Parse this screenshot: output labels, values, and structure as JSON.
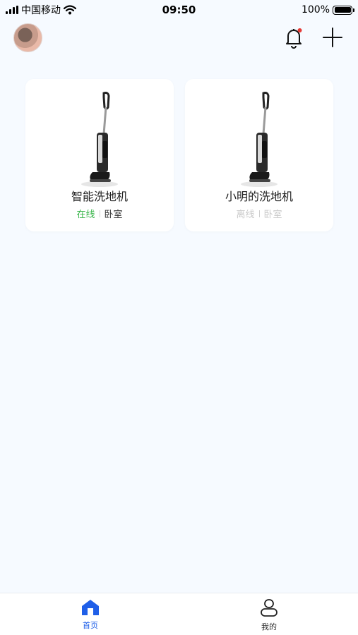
{
  "status_bar": {
    "carrier": "中国移动",
    "time": "09:50",
    "battery": "100%",
    "battery_level": 1.0
  },
  "header": {
    "avatar_icon": "user-avatar",
    "notification_icon": "bell-icon",
    "notification_dot_color": "#e53935",
    "add_icon": "plus-icon"
  },
  "devices": [
    {
      "name": "智能洗地机",
      "status": "在线",
      "room": "卧室",
      "online": true
    },
    {
      "name": "小明的洗地机",
      "status": "离线",
      "room": "卧室",
      "online": false
    }
  ],
  "tabs": [
    {
      "label": "首页",
      "icon": "home-icon",
      "active": true
    },
    {
      "label": "我的",
      "icon": "profile-icon",
      "active": false
    }
  ],
  "colors": {
    "accent": "#1f5fe8",
    "online": "#39b54a",
    "offline": "#c9c9c9",
    "background": "#f6faff"
  }
}
